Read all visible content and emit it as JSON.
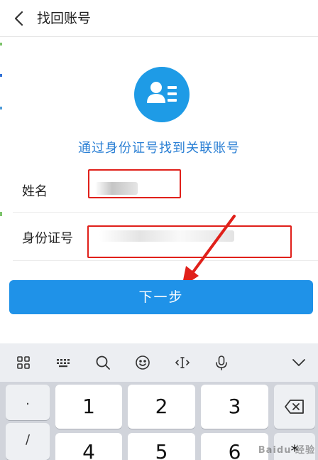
{
  "header": {
    "title": "找回账号",
    "back_icon": "chevron-left-icon"
  },
  "main": {
    "avatar_icon": "id-card-person-icon",
    "subtitle": "通过身份证号找到关联账号",
    "fields": {
      "name_label": "姓名",
      "id_label": "身份证号"
    },
    "next_button": "下一步"
  },
  "keyboard": {
    "toolbar": [
      "grid-icon",
      "keyboard-icon",
      "search-icon",
      "emoji-icon",
      "cursor-icon",
      "microphone-icon",
      "collapse-chevron-icon"
    ],
    "side_keys": [
      ".",
      "/"
    ],
    "row1": [
      "1",
      "2",
      "3"
    ],
    "row2": [
      "4",
      "5",
      "6"
    ],
    "row2_right": "*",
    "delete_icon": "backspace-icon"
  },
  "watermark": "Baidu 经验",
  "colors": {
    "accent": "#1f92e8",
    "subtitle": "#2a7fd4",
    "annotation": "#e0201a"
  }
}
